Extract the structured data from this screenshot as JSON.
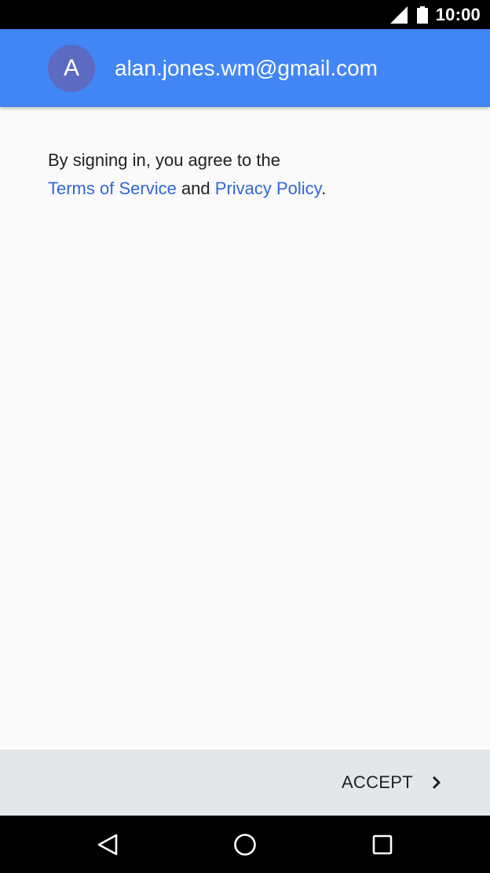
{
  "status_bar": {
    "time": "10:00",
    "icons": [
      "signal-icon",
      "battery-icon"
    ]
  },
  "header": {
    "avatar_letter": "A",
    "email": "alan.jones.wm@gmail.com",
    "background_color": "#4285f4",
    "avatar_color": "#5c6bc0"
  },
  "agreement": {
    "line1": "By signing in, you agree to the",
    "terms_link": "Terms of Service",
    "and_text": " and ",
    "privacy_link": "Privacy Policy",
    "period": ".",
    "link_color": "#3367d6"
  },
  "action_bar": {
    "accept_label": "ACCEPT",
    "icon": "chevron-right-icon"
  },
  "nav_bar": {
    "buttons": [
      "back-icon",
      "home-icon",
      "recents-icon"
    ]
  }
}
